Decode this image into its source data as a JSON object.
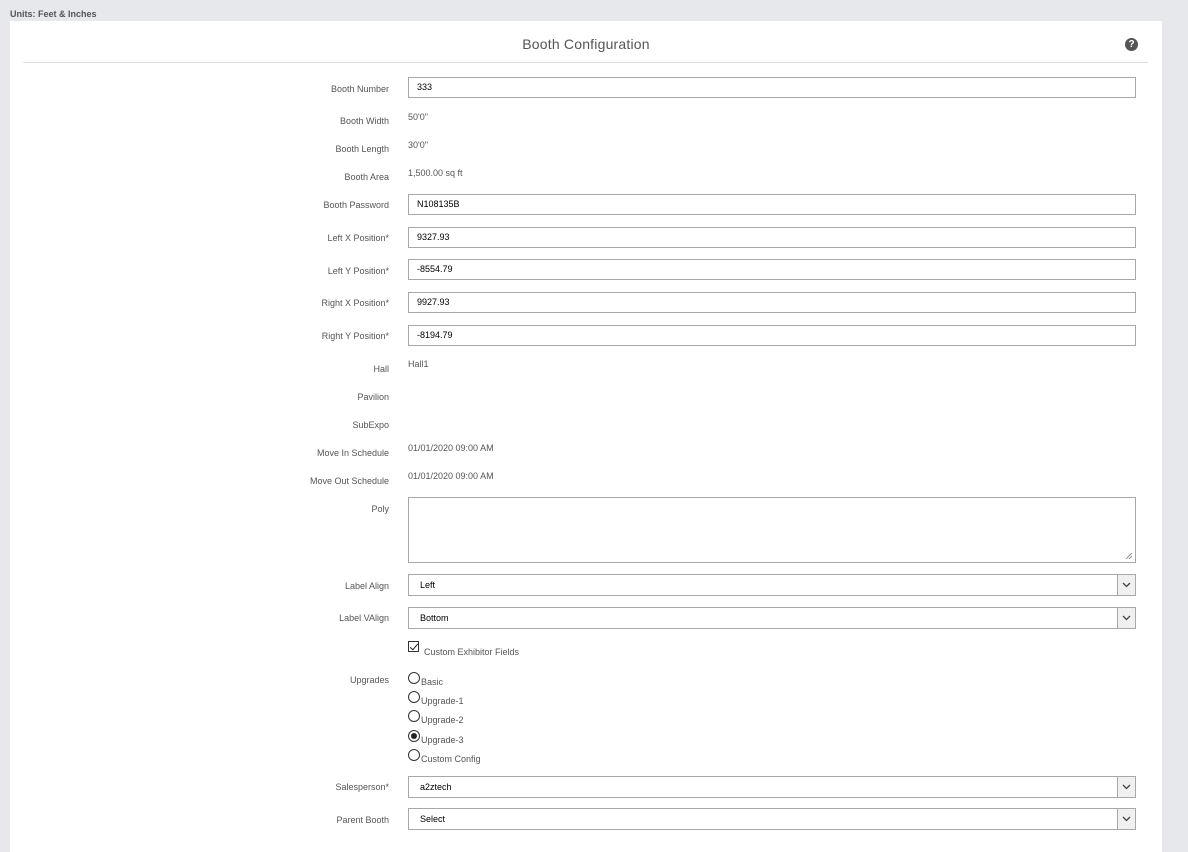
{
  "units_label": "Units: Feet & Inches",
  "title": "Booth Configuration",
  "help_icon": "?",
  "labels": {
    "booth_number": "Booth Number",
    "booth_width": "Booth Width",
    "booth_length": "Booth Length",
    "booth_area": "Booth Area",
    "booth_password": "Booth Password",
    "left_x": "Left X Position*",
    "left_y": "Left Y Position*",
    "right_x": "Right X Position*",
    "right_y": "Right Y Position*",
    "hall": "Hall",
    "pavilion": "Pavilion",
    "subexpo": "SubExpo",
    "move_in": "Move In Schedule",
    "move_out": "Move Out Schedule",
    "poly": "Poly",
    "label_align": "Label Align",
    "label_valign": "Label VAlign",
    "upgrades": "Upgrades",
    "salesperson": "Salesperson*",
    "parent_booth": "Parent Booth"
  },
  "values": {
    "booth_number": "333",
    "booth_width": "50'0\"",
    "booth_length": "30'0\"",
    "booth_area": "1,500.00 sq ft",
    "booth_password": "N108135B",
    "left_x": "9327.93",
    "left_y": "-8554.79",
    "right_x": "9927.93",
    "right_y": "-8194.79",
    "hall": "Hall1",
    "move_in": "01/01/2020 09:00 AM",
    "move_out": "01/01/2020 09:00 AM",
    "label_align": "Left",
    "label_valign": "Bottom",
    "salesperson": "a2ztech",
    "parent_booth": "Select"
  },
  "custom_fields_label": "Custom Exhibitor Fields",
  "upgrades": [
    "Basic",
    "Upgrade-1",
    "Upgrade-2",
    "Upgrade-3",
    "Custom Config"
  ],
  "selected_upgrade": "Upgrade-3"
}
